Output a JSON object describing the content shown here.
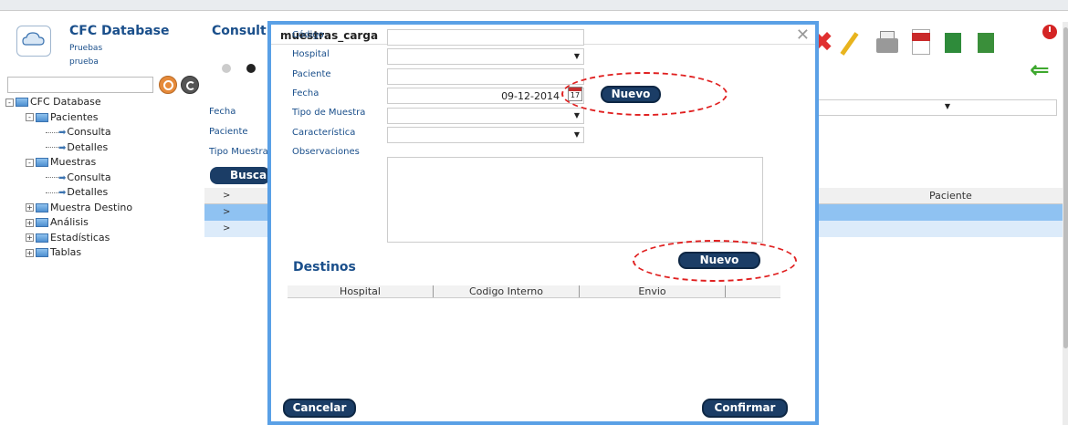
{
  "app": {
    "title": "CFC Database",
    "user_line1": "Pruebas",
    "user_line2": "prueba"
  },
  "sidebar": {
    "tree": [
      {
        "label": "CFC Database",
        "level": 0,
        "toggle": "-",
        "type": "folder"
      },
      {
        "label": "Pacientes",
        "level": 1,
        "toggle": "-",
        "type": "folder"
      },
      {
        "label": "Consulta",
        "level": 2,
        "type": "leaf"
      },
      {
        "label": "Detalles",
        "level": 2,
        "type": "leaf"
      },
      {
        "label": "Muestras",
        "level": 1,
        "toggle": "-",
        "type": "folder"
      },
      {
        "label": "Consulta",
        "level": 2,
        "type": "leaf"
      },
      {
        "label": "Detalles",
        "level": 2,
        "type": "leaf"
      },
      {
        "label": "Muestra Destino",
        "level": 1,
        "toggle": "+",
        "type": "folder"
      },
      {
        "label": "Análisis",
        "level": 1,
        "toggle": "+",
        "type": "folder"
      },
      {
        "label": "Estadísticas",
        "level": 1,
        "toggle": "+",
        "type": "folder"
      },
      {
        "label": "Tablas",
        "level": 1,
        "toggle": "+",
        "type": "folder"
      }
    ]
  },
  "background": {
    "title": "Consult",
    "labels": [
      "Fecha",
      "Paciente",
      "Tipo Muestra"
    ],
    "search_button": "Buscar",
    "grid_row_marker": ">",
    "paciente_header": "Paciente"
  },
  "modal": {
    "title": "muestras_carga",
    "fields": {
      "codigo": "Código",
      "hospital": "Hospital",
      "paciente": "Paciente",
      "fecha": "Fecha",
      "fecha_value": "09-12-2014",
      "tipo_muestra": "Tipo de Muestra",
      "caracteristica": "Característica",
      "observaciones": "Observaciones"
    },
    "calendar_day": "17",
    "nuevo_label": "Nuevo",
    "destinos_title": "Destinos",
    "destinos_columns": [
      "Hospital",
      "Codigo Interno",
      "Envio"
    ],
    "cancel_label": "Cancelar",
    "confirm_label": "Confirmar"
  },
  "colors": {
    "accent": "#1b3d66",
    "modal_border": "#5aa0e6",
    "highlight": "#e02020",
    "selected_row": "#8fc2f2"
  }
}
